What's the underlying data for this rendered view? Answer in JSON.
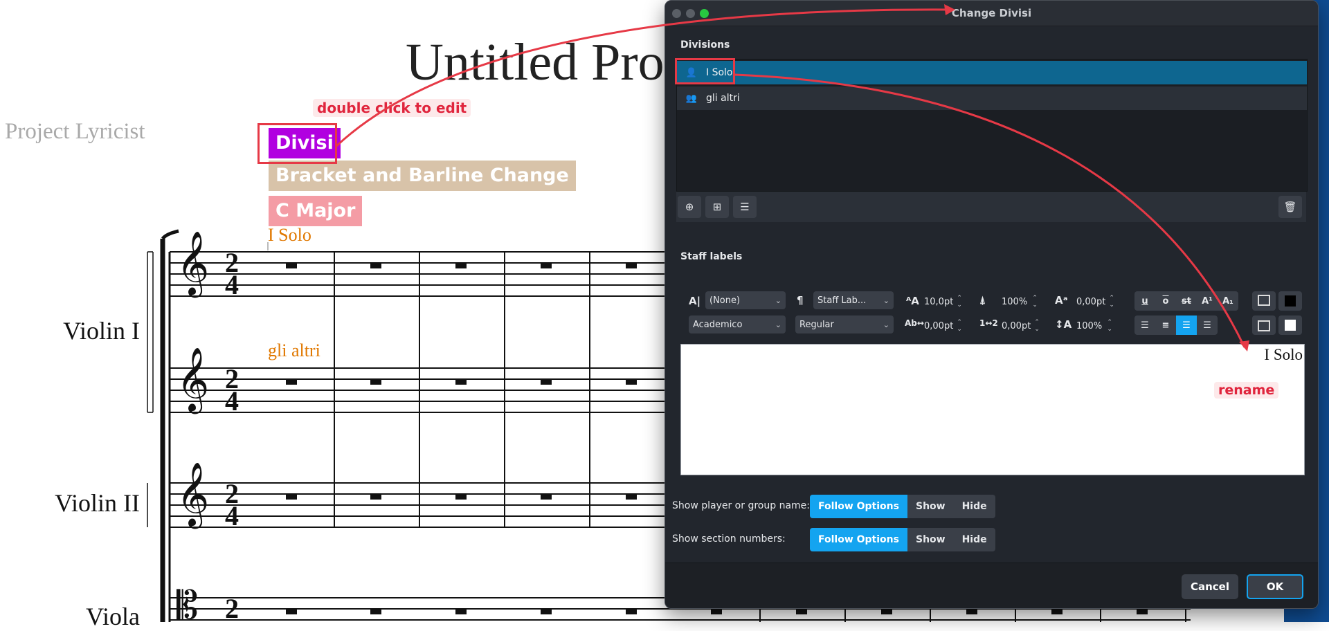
{
  "score": {
    "title_fragment": "Untitled Pro",
    "lyricist": "Project Lyricist",
    "signposts": {
      "divisi": "Divisi",
      "bracket": "Bracket and Barline Change",
      "key": "C Major"
    },
    "staff_texts": {
      "solo": "I Solo",
      "altri": "gli altri"
    },
    "instruments": [
      "Violin I",
      "Violin II",
      "Viola"
    ],
    "time_signature": {
      "top": "2",
      "bottom": "4"
    }
  },
  "annotations": {
    "double_click": "double click to edit",
    "rename": "rename"
  },
  "dialog": {
    "title": "Change Divisi",
    "divisions_label": "Divisions",
    "divisions": [
      "I Solo",
      "gli altri"
    ],
    "selected_division": "I Solo",
    "staff_labels_label": "Staff labels",
    "format": {
      "style": "(None)",
      "paragraph": "Staff Lab...",
      "font": "Academico",
      "weight": "Regular",
      "size": "10,0pt",
      "width_pct": "100%",
      "baseline": "0,00pt",
      "tracking": "0,00pt",
      "spacing": "0,00pt",
      "height_pct": "100%",
      "btn_u": "u",
      "btn_o": "o",
      "btn_st": "st",
      "btn_sup": "A¹",
      "btn_sub": "A₁"
    },
    "label_text": "I Solo",
    "show_player_label": "Show player or group name:",
    "show_section_label": "Show section numbers:",
    "options": [
      "Follow Options",
      "Show",
      "Hide"
    ],
    "cancel": "Cancel",
    "ok": "OK"
  },
  "colors": {
    "divisi_signpost": "#b100e0",
    "bracket_signpost": "#d8c3a9",
    "key_signpost": "#f49ca5",
    "staff_text": "#e07800",
    "selection": "#0e6690",
    "accent": "#14a4f0",
    "annotation": "#e63946"
  }
}
